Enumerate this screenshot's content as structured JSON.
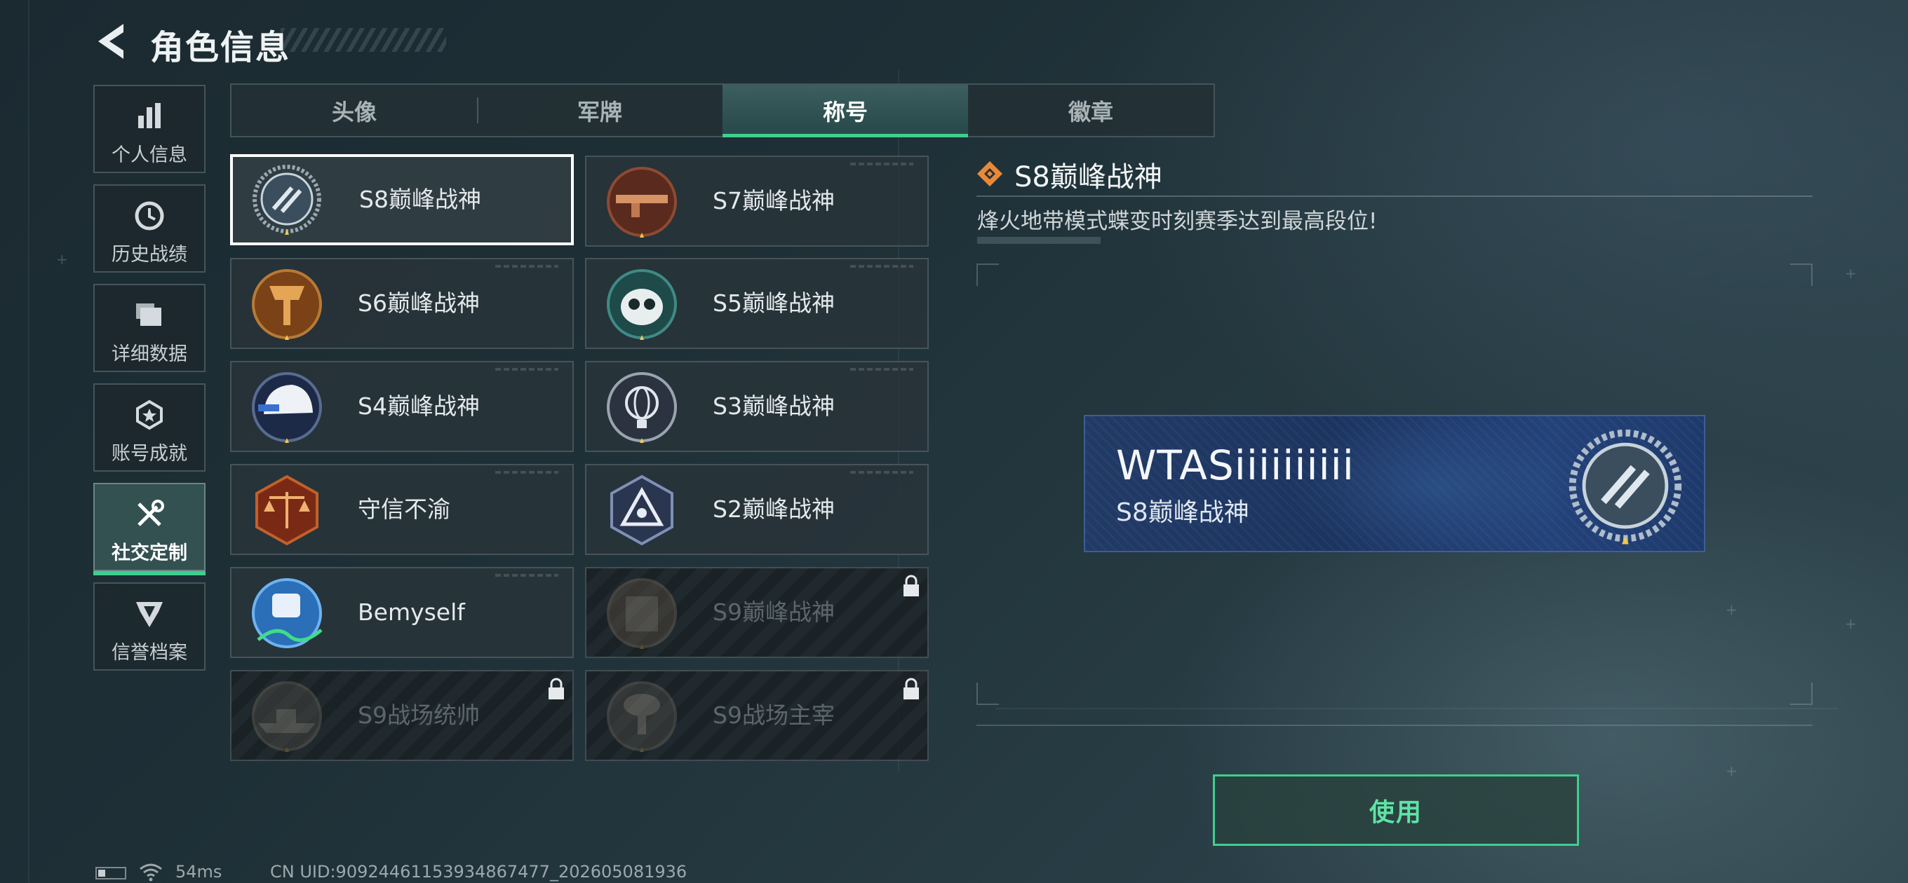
{
  "header": {
    "title": "角色信息"
  },
  "sidebar": {
    "items": [
      {
        "label": "个人信息",
        "icon": "bar-chart-icon",
        "active": false
      },
      {
        "label": "历史战绩",
        "icon": "clock-history-icon",
        "active": false
      },
      {
        "label": "详细数据",
        "icon": "stacked-cards-icon",
        "active": false
      },
      {
        "label": "账号成就",
        "icon": "achievement-medal-icon",
        "active": false
      },
      {
        "label": "社交定制",
        "icon": "wrench-screwdriver-icon",
        "active": true
      },
      {
        "label": "信誉档案",
        "icon": "reputation-shield-icon",
        "active": false
      }
    ]
  },
  "tabs": [
    {
      "label": "头像",
      "active": false
    },
    {
      "label": "军牌",
      "active": false
    },
    {
      "label": "称号",
      "active": true
    },
    {
      "label": "徽章",
      "active": false
    }
  ],
  "titles": [
    {
      "label": "S8巅峰战神",
      "badge": "s8-laurel-badge-icon",
      "selected": true,
      "locked": false
    },
    {
      "label": "S7巅峰战神",
      "badge": "s7-rifle-badge-icon",
      "selected": false,
      "locked": false
    },
    {
      "label": "S6巅峰战神",
      "badge": "s6-shield-badge-icon",
      "selected": false,
      "locked": false
    },
    {
      "label": "S5巅峰战神",
      "badge": "s5-skull-mask-badge-icon",
      "selected": false,
      "locked": false
    },
    {
      "label": "S4巅峰战神",
      "badge": "s4-helmet-badge-icon",
      "selected": false,
      "locked": false
    },
    {
      "label": "S3巅峰战神",
      "badge": "s3-globe-badge-icon",
      "selected": false,
      "locked": false
    },
    {
      "label": "守信不渝",
      "badge": "scales-badge-icon",
      "selected": false,
      "locked": false
    },
    {
      "label": "S2巅峰战神",
      "badge": "s2-triangle-badge-icon",
      "selected": false,
      "locked": false
    },
    {
      "label": "Bemyself",
      "badge": "signature-badge-icon",
      "selected": false,
      "locked": false
    },
    {
      "label": "S9巅峰战神",
      "badge": "s9-building-badge-icon",
      "selected": false,
      "locked": true
    },
    {
      "label": "S9战场统帅",
      "badge": "s9-warship-badge-icon",
      "selected": false,
      "locked": true
    },
    {
      "label": "S9战场主宰",
      "badge": "s9-mushroom-cloud-badge-icon",
      "selected": false,
      "locked": true
    }
  ],
  "detail": {
    "title": "S8巅峰战神",
    "description": "烽火地带模式蝶变时刻赛季达到最高段位!",
    "preview": {
      "player_name": "WTASiiiiiiiiii",
      "title": "S8巅峰战神"
    }
  },
  "use_button": {
    "label": "使用"
  },
  "status": {
    "ping": "54ms",
    "uid": "CN UID:9092446115393486​7477_202605081936"
  },
  "colors": {
    "accent": "#3fcf8e",
    "detail_icon": "#e8893a",
    "nameplate": "#213a66"
  }
}
